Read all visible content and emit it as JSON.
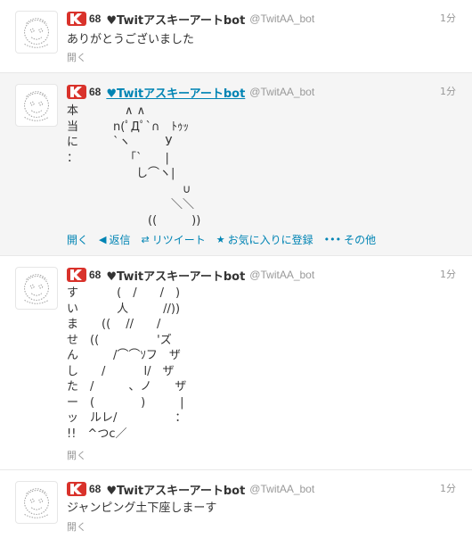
{
  "colors": {
    "accent": "#0084b4",
    "badge": "#d9322b",
    "highlight_bg": "#f5f5f5"
  },
  "tweets": [
    {
      "count": "68",
      "fullname": "♥Twitアスキーアートbot",
      "username": "@TwitAA_bot",
      "time": "1分",
      "text": "ありがとうございました",
      "open": "開く",
      "avatar_icon": "ascii-face-avatar-icon"
    },
    {
      "count": "68",
      "fullname": "♥Twitアスキーアートbot",
      "username": "@TwitAA_bot",
      "time": "1分",
      "text": "本　　　　∧ ∧\n当　　　n(ﾟДﾟ`∩　ﾄｩｯ\nに　　　`ヽ　　　У\n：　　　　　「`　　|\n　　　　　　し⌒ヽ|\n　　　　　　　　　　∪\n　　　　　　　　　＼＼\n　　　　　　　((　　　))",
      "actions": {
        "open": "開く",
        "reply": "返信",
        "retweet": "リツイート",
        "favorite": "お気に入りに登録",
        "more": "その他"
      },
      "avatar_icon": "ascii-face-avatar-icon"
    },
    {
      "count": "68",
      "fullname": "♥Twitアスキーアートbot",
      "username": "@TwitAA_bot",
      "time": "1分",
      "text": "す　　　 (　/　　/　)\nい　　　 人　　　//))\nま　　(( 　//　　/\nせ　((　　　　　'ズ\nん　　　/⌒⌒ｿフ　ザ\nし　　/　　　 l/　ザ\nた　/　　　、ノ　　ザ\nー　(　　　　)　　　|\nッ　ルレ/　　　　　：\n!!　^つc／",
      "open": "開く",
      "avatar_icon": "ascii-face-avatar-icon"
    },
    {
      "count": "68",
      "fullname": "♥Twitアスキーアートbot",
      "username": "@TwitAA_bot",
      "time": "1分",
      "text": "ジャンピング土下座しまーす",
      "open": "開く",
      "avatar_icon": "ascii-face-avatar-icon"
    }
  ]
}
